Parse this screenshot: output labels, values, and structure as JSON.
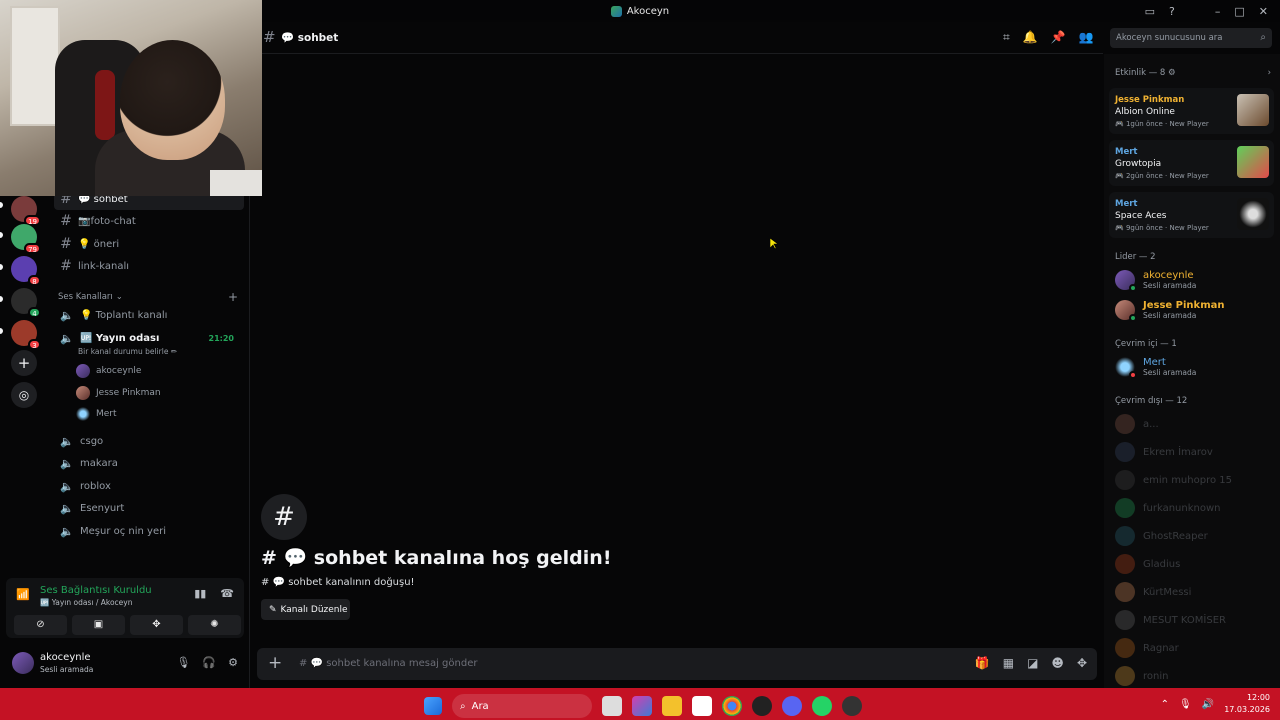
{
  "window": {
    "title": "Akoceyn"
  },
  "servers": [
    {
      "badge": "19",
      "color": "#7a3b3b"
    },
    {
      "badge": "79",
      "color": "#3fa86a"
    },
    {
      "badge": "8",
      "color": "#5b3fb0"
    },
    {
      "badge": "4",
      "color": "#2b2b2b"
    },
    {
      "badge": "3",
      "color": "#9c3a2a"
    }
  ],
  "channels": {
    "text": [
      {
        "name": "💬 sohbet",
        "active": true
      },
      {
        "name": "📷foto-chat"
      },
      {
        "name": "💡 öneri"
      },
      {
        "name": "link-kanalı"
      }
    ],
    "voice_category": "Ses Kanalları",
    "voice": [
      {
        "name": "💡 Toplantı kanalı"
      },
      {
        "name": "🆙 Yayın odası",
        "time": "21:20",
        "status": "Bir kanal durumu belirle ✏"
      }
    ],
    "voice_users": [
      "akoceynle",
      "Jesse Pinkman",
      "Mert"
    ],
    "other_voice": [
      "csgo",
      "makara",
      "roblox",
      "Esenyurt",
      "Meşur oç nin yeri"
    ]
  },
  "voice_panel": {
    "title": "Ses Bağlantısı Kuruldu",
    "subtitle": "🆙 Yayın odası / Akoceyn"
  },
  "user": {
    "name": "akoceynle",
    "status": "Sesli aramada"
  },
  "header": {
    "channel": "💬 sohbet",
    "search_placeholder": "Akoceyn sunucusunu ara"
  },
  "welcome": {
    "title": "# 💬 sohbet kanalına hoş geldin!",
    "subtitle": "# 💬 sohbet kanalının doğuşu!",
    "edit_button": "Kanalı Düzenle"
  },
  "composer": {
    "placeholder": "# 💬 sohbet kanalına mesaj gönder"
  },
  "members": {
    "activity_header": "Etkinlik — 8 ⚙",
    "activities": [
      {
        "user": "Jesse Pinkman",
        "user_color": "#f0b232",
        "game": "Albion Online",
        "when": "1gün önce",
        "tag": "New Player"
      },
      {
        "user": "Mert",
        "user_color": "#5ea5e0",
        "game": "Growtopia",
        "when": "2gün önce",
        "tag": "New Player"
      },
      {
        "user": "Mert",
        "user_color": "#5ea5e0",
        "game": "Space Aces",
        "when": "9gün önce",
        "tag": "New Player"
      }
    ],
    "leader_header": "Lider — 2",
    "leaders": [
      {
        "name": "akoceynle",
        "status": "Sesli aramada",
        "color": "#f0b232"
      },
      {
        "name": "Jesse Pinkman",
        "status": "Sesli aramada",
        "color": "#f0b232"
      }
    ],
    "online_header": "Çevrim içi — 1",
    "online": [
      {
        "name": "Mert",
        "status": "Sesli aramada",
        "color": "#5ea5e0"
      }
    ],
    "offline_header": "Çevrim dışı — 12",
    "offline": [
      "a...",
      "Ekrem İmarov",
      "emin muhopro 15",
      "furkanunknown",
      "GhostReaper",
      "Gladius",
      "KürtMessi",
      "MESUT KOMİSER",
      "Ragnar",
      "ronin"
    ]
  },
  "taskbar": {
    "search": "Ara",
    "time": "12:00",
    "date": "17.03.2026"
  }
}
